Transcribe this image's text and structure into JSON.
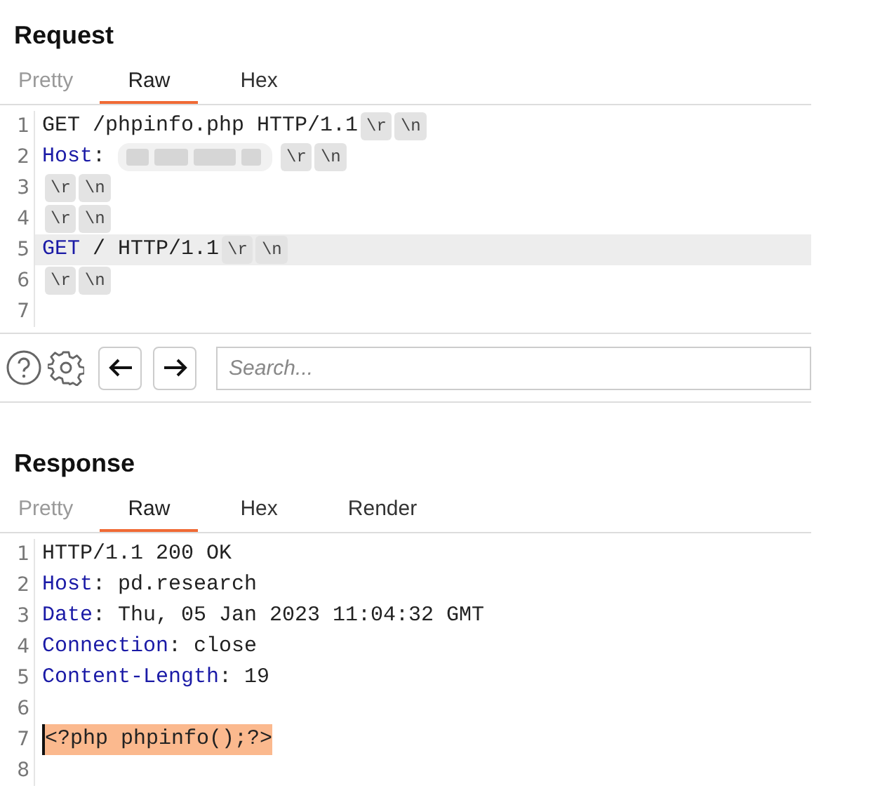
{
  "panels": [
    {
      "title": "Request",
      "tabs": [
        {
          "label": "Pretty",
          "selected": false
        },
        {
          "label": "Raw",
          "selected": true
        },
        {
          "label": "Hex",
          "selected": false
        }
      ],
      "lines": [
        {
          "number": "1",
          "highlighted": false,
          "tokens": [
            {
              "kind": "plain",
              "text": "GET /phpinfo.php HTTP/1.1"
            },
            {
              "kind": "crlf",
              "text": "\\r"
            },
            {
              "kind": "crlf",
              "text": "\\n"
            }
          ]
        },
        {
          "number": "2",
          "highlighted": false,
          "tokens": [
            {
              "kind": "keyword",
              "text": "Host"
            },
            {
              "kind": "plain",
              "text": ": "
            },
            {
              "kind": "redacted"
            },
            {
              "kind": "crlf",
              "text": "\\r"
            },
            {
              "kind": "crlf",
              "text": "\\n"
            }
          ]
        },
        {
          "number": "3",
          "highlighted": false,
          "tokens": [
            {
              "kind": "crlf",
              "text": "\\r"
            },
            {
              "kind": "crlf",
              "text": "\\n"
            }
          ]
        },
        {
          "number": "4",
          "highlighted": false,
          "tokens": [
            {
              "kind": "crlf",
              "text": "\\r"
            },
            {
              "kind": "crlf",
              "text": "\\n"
            }
          ]
        },
        {
          "number": "5",
          "highlighted": true,
          "tokens": [
            {
              "kind": "keyword",
              "text": "GET"
            },
            {
              "kind": "plain",
              "text": " / HTTP/1.1"
            },
            {
              "kind": "crlf",
              "text": "\\r"
            },
            {
              "kind": "crlf",
              "text": "\\n"
            }
          ]
        },
        {
          "number": "6",
          "highlighted": false,
          "tokens": [
            {
              "kind": "crlf",
              "text": "\\r"
            },
            {
              "kind": "crlf",
              "text": "\\n"
            }
          ]
        },
        {
          "number": "7",
          "highlighted": false
        }
      ],
      "search": {
        "placeholder": "Search..."
      }
    },
    {
      "title": "Response",
      "tabs": [
        {
          "label": "Pretty",
          "selected": false
        },
        {
          "label": "Raw",
          "selected": true
        },
        {
          "label": "Hex",
          "selected": false
        },
        {
          "label": "Render",
          "selected": false
        }
      ],
      "lines": [
        {
          "number": "1",
          "highlighted": false,
          "tokens": [
            {
              "kind": "plain",
              "text": "HTTP/1.1 200 OK"
            }
          ]
        },
        {
          "number": "2",
          "highlighted": false,
          "tokens": [
            {
              "kind": "keyword",
              "text": "Host"
            },
            {
              "kind": "plain",
              "text": ": pd.research"
            }
          ]
        },
        {
          "number": "3",
          "highlighted": false,
          "tokens": [
            {
              "kind": "keyword",
              "text": "Date"
            },
            {
              "kind": "plain",
              "text": ": Thu, 05 Jan 2023 11:04:32 GMT"
            }
          ]
        },
        {
          "number": "4",
          "highlighted": false,
          "tokens": [
            {
              "kind": "keyword",
              "text": "Connection"
            },
            {
              "kind": "plain",
              "text": ": close"
            }
          ]
        },
        {
          "number": "5",
          "highlighted": false,
          "tokens": [
            {
              "kind": "keyword",
              "text": "Content-Length"
            },
            {
              "kind": "plain",
              "text": ": 19"
            }
          ]
        },
        {
          "number": "6",
          "highlighted": false
        },
        {
          "number": "7",
          "highlighted": false,
          "tokens": [
            {
              "kind": "selected",
              "text": "<?php phpinfo();?>"
            }
          ]
        },
        {
          "number": "8",
          "highlighted": false
        }
      ]
    }
  ]
}
